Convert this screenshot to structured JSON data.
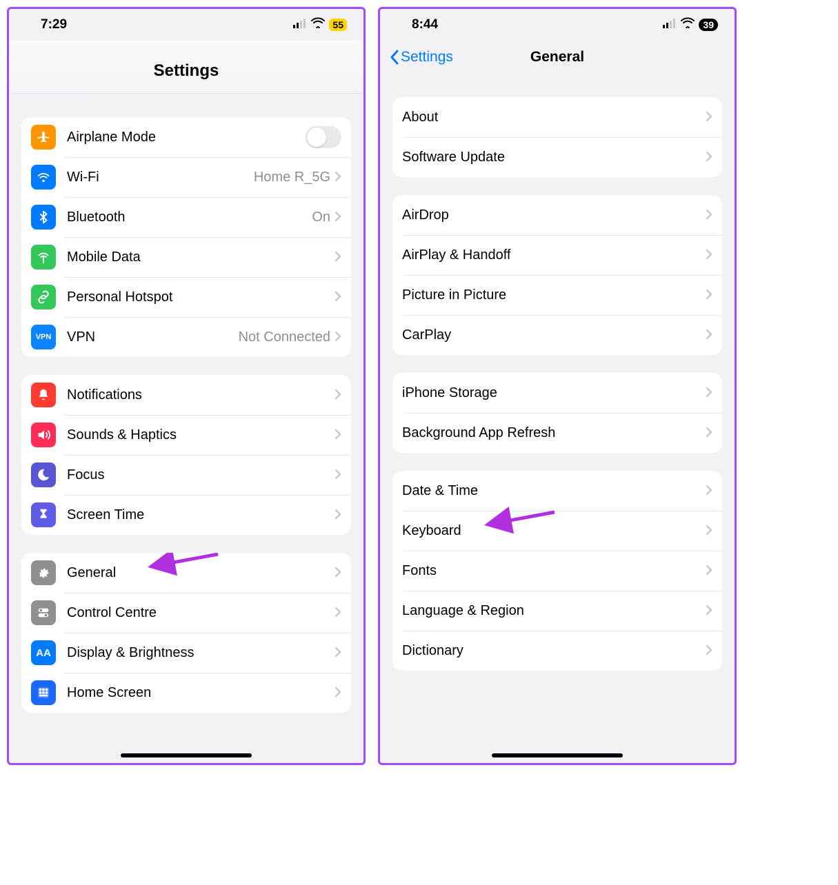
{
  "left": {
    "status": {
      "time": "7:29",
      "battery": "55"
    },
    "title": "Settings",
    "groups": [
      [
        {
          "icon": "airplane",
          "label": "Airplane Mode",
          "type": "toggle"
        },
        {
          "icon": "wifi",
          "label": "Wi-Fi",
          "value": "Home R_5G",
          "type": "chev"
        },
        {
          "icon": "bluetooth",
          "label": "Bluetooth",
          "value": "On",
          "type": "chev"
        },
        {
          "icon": "mobile",
          "label": "Mobile Data",
          "type": "chev"
        },
        {
          "icon": "hotspot",
          "label": "Personal Hotspot",
          "type": "chev"
        },
        {
          "icon": "vpn",
          "label": "VPN",
          "value": "Not Connected",
          "type": "chev"
        }
      ],
      [
        {
          "icon": "notif",
          "label": "Notifications",
          "type": "chev"
        },
        {
          "icon": "sound",
          "label": "Sounds & Haptics",
          "type": "chev"
        },
        {
          "icon": "focus",
          "label": "Focus",
          "type": "chev"
        },
        {
          "icon": "screen",
          "label": "Screen Time",
          "type": "chev"
        }
      ],
      [
        {
          "icon": "general",
          "label": "General",
          "type": "chev",
          "arrow": true
        },
        {
          "icon": "control",
          "label": "Control Centre",
          "type": "chev"
        },
        {
          "icon": "display",
          "label": "Display & Brightness",
          "type": "chev"
        },
        {
          "icon": "home",
          "label": "Home Screen",
          "type": "chev"
        }
      ]
    ]
  },
  "right": {
    "status": {
      "time": "8:44",
      "battery": "39"
    },
    "back": "Settings",
    "title": "General",
    "groups": [
      [
        {
          "label": "About",
          "type": "chev"
        },
        {
          "label": "Software Update",
          "type": "chev"
        }
      ],
      [
        {
          "label": "AirDrop",
          "type": "chev"
        },
        {
          "label": "AirPlay & Handoff",
          "type": "chev"
        },
        {
          "label": "Picture in Picture",
          "type": "chev"
        },
        {
          "label": "CarPlay",
          "type": "chev"
        }
      ],
      [
        {
          "label": "iPhone Storage",
          "type": "chev"
        },
        {
          "label": "Background App Refresh",
          "type": "chev"
        }
      ],
      [
        {
          "label": "Date & Time",
          "type": "chev"
        },
        {
          "label": "Keyboard",
          "type": "chev",
          "arrow": true
        },
        {
          "label": "Fonts",
          "type": "chev"
        },
        {
          "label": "Language & Region",
          "type": "chev"
        },
        {
          "label": "Dictionary",
          "type": "chev"
        }
      ]
    ]
  },
  "icon_meta": {
    "airplane": {
      "cls": "c-orange",
      "glyph": "airplane"
    },
    "wifi": {
      "cls": "c-blue",
      "glyph": "wifi"
    },
    "bluetooth": {
      "cls": "c-blue",
      "glyph": "bt"
    },
    "mobile": {
      "cls": "c-green",
      "glyph": "antenna"
    },
    "hotspot": {
      "cls": "c-green",
      "glyph": "link"
    },
    "vpn": {
      "cls": "vpn-box",
      "glyph": "vpn"
    },
    "notif": {
      "cls": "c-red",
      "glyph": "bell"
    },
    "sound": {
      "cls": "c-pink",
      "glyph": "speaker"
    },
    "focus": {
      "cls": "c-indigo",
      "glyph": "moon"
    },
    "screen": {
      "cls": "c-purple",
      "glyph": "hourglass"
    },
    "general": {
      "cls": "c-grey",
      "glyph": "gear"
    },
    "control": {
      "cls": "c-grey2",
      "glyph": "toggles"
    },
    "display": {
      "cls": "c-blue",
      "glyph": "AA"
    },
    "home": {
      "cls": "c-row",
      "glyph": "grid"
    }
  }
}
